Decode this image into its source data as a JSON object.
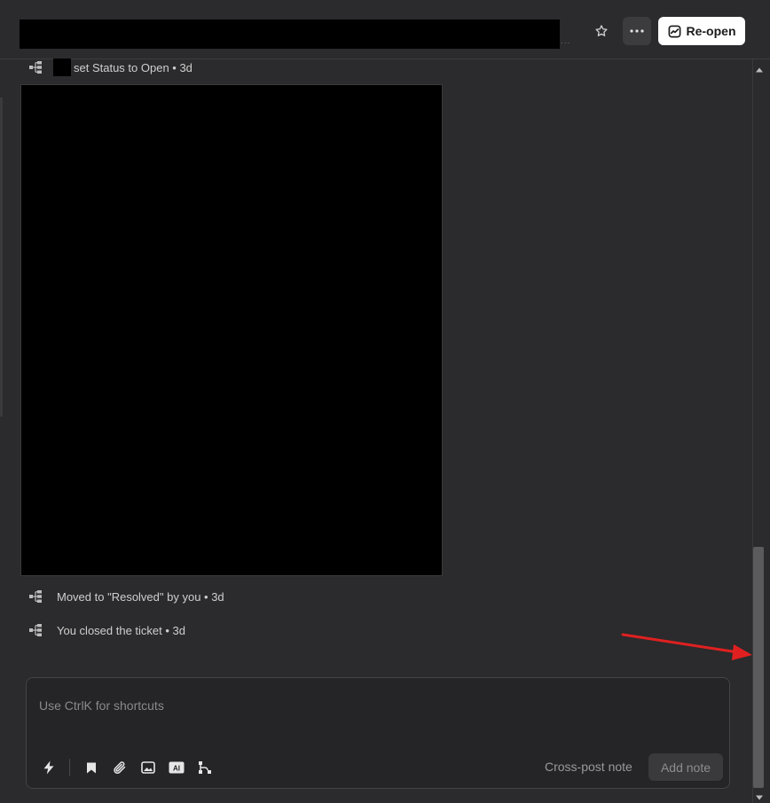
{
  "header": {
    "title_dots": "...",
    "reopen_label": "Re-open"
  },
  "activities": [
    {
      "text": "set Status to Open • 3d"
    },
    {
      "text": "Moved to \"Resolved\" by you • 3d"
    },
    {
      "text": "You closed the ticket • 3d"
    }
  ],
  "composer": {
    "placeholder": "Use CtrlK for shortcuts",
    "cross_post_label": "Cross-post note",
    "add_note_label": "Add note"
  },
  "icons": {
    "activity": "workflow-icon",
    "star": "star-icon",
    "more": "more-horizontal-icon",
    "reopen": "reopen-icon",
    "tools": [
      "lightning-icon",
      "bookmark-icon",
      "paperclip-icon",
      "image-icon",
      "ai-icon",
      "branch-icon"
    ]
  },
  "colors": {
    "background": "#2b2a2c",
    "annotation_arrow": "#e02020"
  }
}
